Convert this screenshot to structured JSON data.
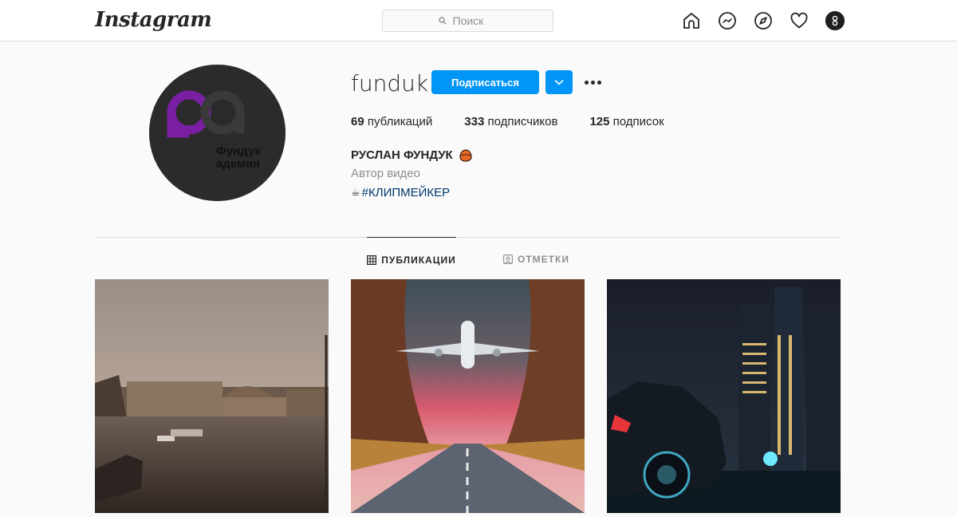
{
  "topbar": {
    "logo": "Instagram",
    "search_placeholder": "Поиск",
    "icons": [
      "home-icon",
      "messenger-icon",
      "explore-icon",
      "activity-heart-icon",
      "profile-avatar-icon"
    ]
  },
  "profile": {
    "username": "funduk",
    "follow_button": "Подписаться",
    "stats": {
      "posts_count": "69",
      "posts_label": "публикаций",
      "followers_count": "333",
      "followers_label": "подписчиков",
      "following_count": "125",
      "following_label": "подписок"
    },
    "full_name": "РУСЛАН ФУНДУК",
    "category": "Автор видео",
    "bio_emoji": "☕",
    "bio_hashtag": "#КЛИПМЕЙКЕР",
    "avatar_logo_text_line1": "Фундук",
    "avatar_logo_text_line2": "адемия"
  },
  "tabs": [
    {
      "label": "ПУБЛИКАЦИИ",
      "active": true
    },
    {
      "label": "ОТМЕТКИ",
      "active": false
    }
  ],
  "posts": [
    {
      "name": "post-canal-sunset"
    },
    {
      "name": "post-airplane-road"
    },
    {
      "name": "post-night-city-car"
    }
  ],
  "colors": {
    "accent": "#0095f6",
    "background": "#fafafa",
    "border": "#dbdbdb",
    "text": "#262626",
    "muted": "#8e8e8e",
    "hashtag": "#00376b",
    "logo_purple": "#7b1fa2"
  }
}
